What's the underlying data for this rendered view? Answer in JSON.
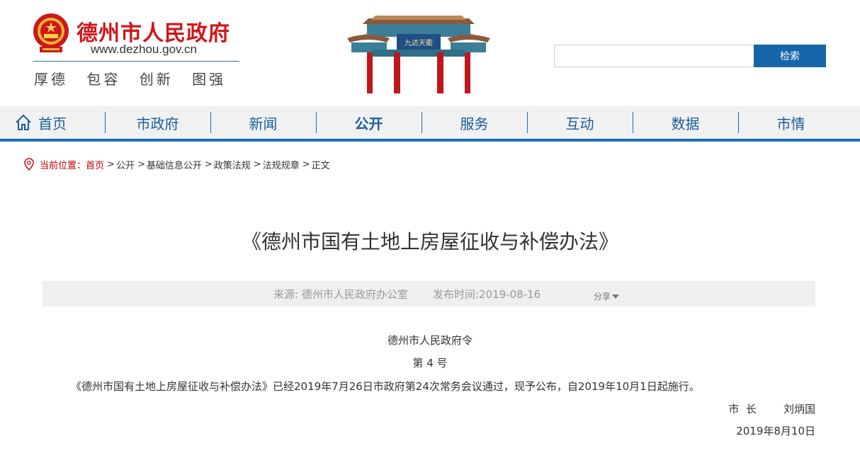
{
  "header": {
    "site_title": "德州市人民政府",
    "site_url": "www.dezhou.gov.cn",
    "motto": "厚德 包容 创新 图强",
    "arch_sign": "九达天衢"
  },
  "search": {
    "placeholder": "",
    "button_label": "检索"
  },
  "nav": {
    "items": [
      {
        "label": "首页"
      },
      {
        "label": "市政府"
      },
      {
        "label": "新闻"
      },
      {
        "label": "公开"
      },
      {
        "label": "服务"
      },
      {
        "label": "互动"
      },
      {
        "label": "数据"
      },
      {
        "label": "市情"
      }
    ],
    "active_index": 3
  },
  "breadcrumb": {
    "prefix": "当前位置：",
    "items": [
      "首页",
      "公开",
      "基础信息公开",
      "政策法规",
      "法规规章",
      "正文"
    ],
    "separator": ">"
  },
  "article": {
    "title": "《德州市国有土地上房屋征收与补偿办法》",
    "source": "来源: 德州市人民政府办公室",
    "publish_time": "发布时间:2019-08-16",
    "share_label": "分享",
    "decree": "德州市人民政府令",
    "number": "第 4 号",
    "body": "《德州市国有土地上房屋征收与补偿办法》已经2019年7月26日市政府第24次常务会议通过，现予公布，自2019年10月1日起施行。",
    "signature": "市  长        刘炳国",
    "sign_date": "2019年8月10日"
  },
  "colors": {
    "brand_red": "#d0161b",
    "nav_blue": "#1a6db5",
    "search_blue": "#1565a8"
  }
}
